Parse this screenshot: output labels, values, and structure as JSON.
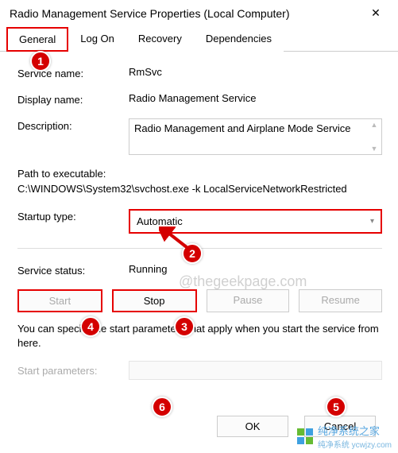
{
  "window": {
    "title": "Radio Management Service Properties (Local Computer)"
  },
  "tabs": {
    "general": "General",
    "logon": "Log On",
    "recovery": "Recovery",
    "dependencies": "Dependencies"
  },
  "labels": {
    "service_name": "Service name:",
    "display_name": "Display name:",
    "description": "Description:",
    "path_label": "Path to executable:",
    "startup_type": "Startup type:",
    "service_status": "Service status:",
    "hint": "You can specify the start parameters that apply when you start the service from here.",
    "start_params": "Start parameters:"
  },
  "values": {
    "service_name": "RmSvc",
    "display_name": "Radio Management Service",
    "description": "Radio Management and Airplane Mode Service",
    "path": "C:\\WINDOWS\\System32\\svchost.exe -k LocalServiceNetworkRestricted",
    "startup_type": "Automatic",
    "service_status": "Running",
    "start_params": ""
  },
  "buttons": {
    "start": "Start",
    "stop": "Stop",
    "pause": "Pause",
    "resume": "Resume",
    "ok": "OK",
    "cancel": "Cancel"
  },
  "annotations": {
    "b1": "1",
    "b2": "2",
    "b3": "3",
    "b4": "4",
    "b5": "5",
    "b6": "6"
  },
  "watermark": {
    "center": "@thegeekpage.com",
    "footer_main": "纯净系统之家",
    "footer_sub": "纯净系统 ycwjzy.com"
  }
}
